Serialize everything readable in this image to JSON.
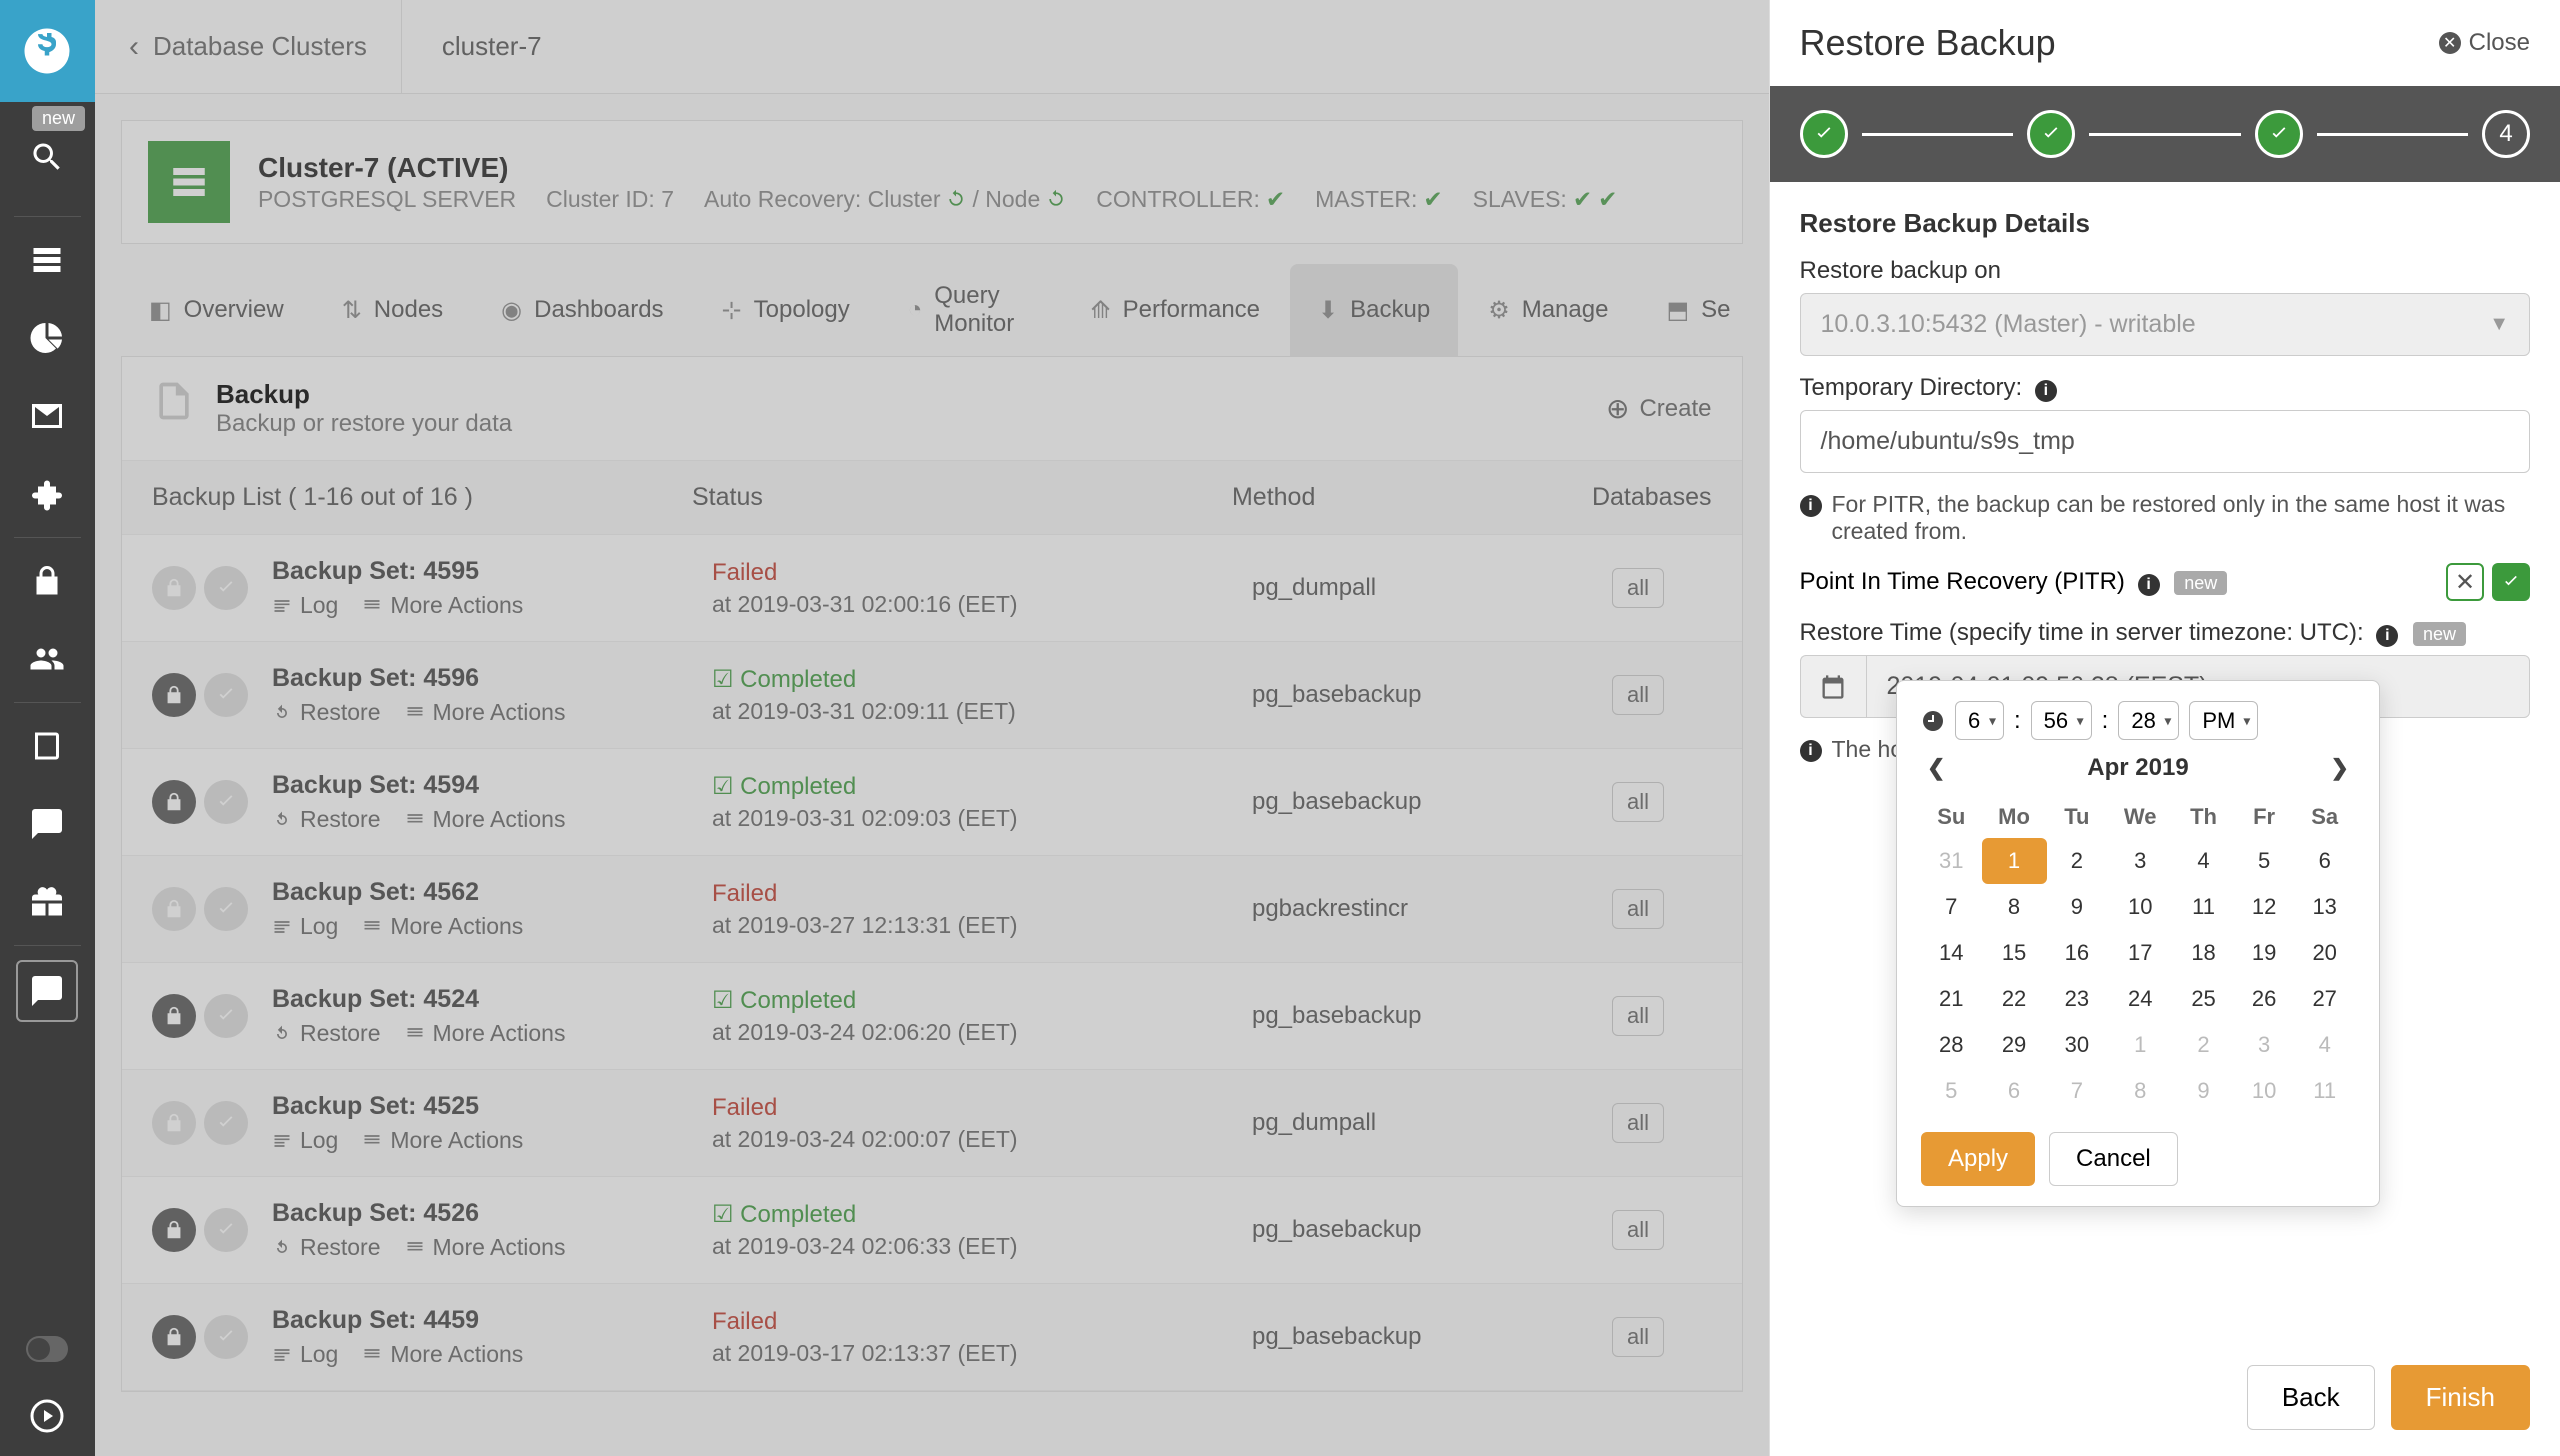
{
  "rail": {
    "new_badge": "new"
  },
  "breadcrumb": {
    "root": "Database Clusters",
    "current": "cluster-7"
  },
  "header": {
    "title": "Cluster-7 (ACTIVE)",
    "subtitle": "POSTGRESQL SERVER",
    "cluster_id_label": "Cluster ID: 7",
    "auto_recovery": "Auto Recovery: Cluster",
    "auto_recovery_node": "/ Node",
    "controller": "CONTROLLER:",
    "master": "MASTER:",
    "slaves": "SLAVES:"
  },
  "tabs": [
    "Overview",
    "Nodes",
    "Dashboards",
    "Topology",
    "Query Monitor",
    "Performance",
    "Backup",
    "Manage",
    "Se"
  ],
  "panel": {
    "title": "Backup",
    "subtitle": "Backup or restore your data",
    "create": "Create",
    "list_label": "Backup List ( 1-16 out of 16 )",
    "cols": {
      "status": "Status",
      "method": "Method",
      "db": "Databases"
    },
    "labels": {
      "log": "Log",
      "restore": "Restore",
      "more": "More Actions",
      "completed": "Completed",
      "failed": "Failed",
      "at_prefix": "at ",
      "all": "all"
    }
  },
  "rows": [
    {
      "id": "4595",
      "lock": false,
      "status": "Failed",
      "ts": "2019-03-31 02:00:16 (EET)",
      "method": "pg_dumpall",
      "action": "log"
    },
    {
      "id": "4596",
      "lock": true,
      "status": "Completed",
      "ts": "2019-03-31 02:09:11 (EET)",
      "method": "pg_basebackup",
      "action": "restore"
    },
    {
      "id": "4594",
      "lock": true,
      "status": "Completed",
      "ts": "2019-03-31 02:09:03 (EET)",
      "method": "pg_basebackup",
      "action": "restore"
    },
    {
      "id": "4562",
      "lock": false,
      "status": "Failed",
      "ts": "2019-03-27 12:13:31 (EET)",
      "method": "pgbackrestincr",
      "action": "log"
    },
    {
      "id": "4524",
      "lock": true,
      "status": "Completed",
      "ts": "2019-03-24 02:06:20 (EET)",
      "method": "pg_basebackup",
      "action": "restore"
    },
    {
      "id": "4525",
      "lock": false,
      "status": "Failed",
      "ts": "2019-03-24 02:00:07 (EET)",
      "method": "pg_dumpall",
      "action": "log"
    },
    {
      "id": "4526",
      "lock": true,
      "status": "Completed",
      "ts": "2019-03-24 02:06:33 (EET)",
      "method": "pg_basebackup",
      "action": "restore"
    },
    {
      "id": "4459",
      "lock": true,
      "status": "Failed",
      "ts": "2019-03-17 02:13:37 (EET)",
      "method": "pg_basebackup",
      "action": "log"
    }
  ],
  "side": {
    "title": "Restore Backup",
    "close": "Close",
    "step4": "4",
    "details_heading": "Restore Backup Details",
    "restore_on_label": "Restore backup on",
    "restore_on_value": "10.0.3.10:5432 (Master) - writable",
    "tmpdir_label": "Temporary Directory:",
    "tmpdir_value": "/home/ubuntu/s9s_tmp",
    "pitr_note": "For PITR, the backup can be restored only in the same host it was created from.",
    "pitr_label": "Point In Time Recovery (PITR)",
    "new_badge": "new",
    "restore_time_label": "Restore Time (specify time in server timezone: UTC):",
    "restore_time_value": "2019-04-01 09:56:28 (EEST)",
    "host_note": "The host 10.0.",
    "back": "Back",
    "finish": "Finish"
  },
  "picker": {
    "hour": "6",
    "min": "56",
    "sec": "28",
    "ampm": "PM",
    "month": "Apr 2019",
    "dow": [
      "Su",
      "Mo",
      "Tu",
      "We",
      "Th",
      "Fr",
      "Sa"
    ],
    "cells": [
      [
        "31m",
        "1s",
        "2",
        "3",
        "4",
        "5",
        "6"
      ],
      [
        "7",
        "8",
        "9",
        "10",
        "11",
        "12",
        "13"
      ],
      [
        "14",
        "15",
        "16",
        "17",
        "18",
        "19",
        "20"
      ],
      [
        "21",
        "22",
        "23",
        "24",
        "25",
        "26",
        "27"
      ],
      [
        "28",
        "29",
        "30",
        "1m",
        "2m",
        "3m",
        "4m"
      ],
      [
        "5m",
        "6m",
        "7m",
        "8m",
        "9m",
        "10m",
        "11m"
      ]
    ],
    "apply": "Apply",
    "cancel": "Cancel"
  }
}
